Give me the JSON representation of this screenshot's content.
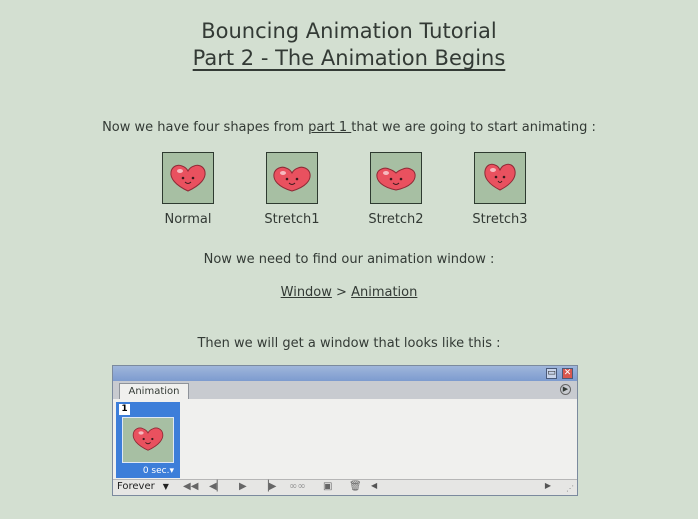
{
  "header": {
    "title": "Bouncing Animation Tutorial",
    "subtitle": "Part 2 - The Animation Begins"
  },
  "intro": {
    "before": "Now we have four shapes from ",
    "link": "part 1 ",
    "after": "that we are going to start animating :"
  },
  "shapes": [
    {
      "label": "Normal"
    },
    {
      "label": "Stretch1"
    },
    {
      "label": "Stretch2"
    },
    {
      "label": "Stretch3"
    }
  ],
  "find_window": "Now we need to find our animation window :",
  "menu_path": {
    "window": "Window",
    "sep": " > ",
    "animation": "Animation"
  },
  "then_text": "Then we will get a window that looks like this :",
  "panel": {
    "tab": "Animation",
    "frame_number": "1",
    "frame_delay": "0 sec.",
    "loop": "Forever"
  },
  "colors": {
    "background": "#d3dfd1",
    "shape_bg": "#a7bfa3",
    "heart": "#e9515f",
    "frame_selected": "#3d7ed9"
  }
}
